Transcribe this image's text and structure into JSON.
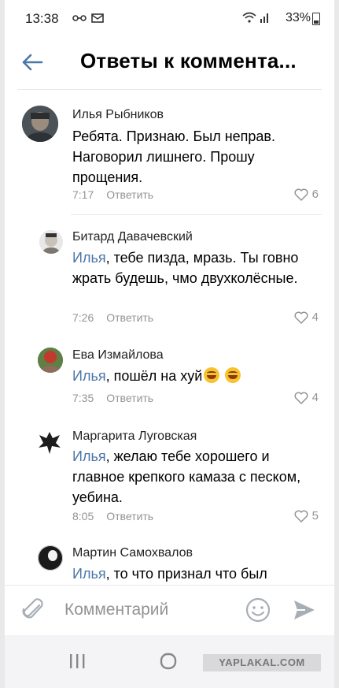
{
  "status_bar": {
    "time": "13:38",
    "battery": "33%"
  },
  "header": {
    "title": "Ответы к коммента..."
  },
  "comments": [
    {
      "author": "Илья Рыбников",
      "mention": "",
      "text": "Ребята. Признаю. Был неправ. Наговорил лишнего. Прошу прощения.",
      "time": "7:17",
      "reply_label": "Ответить",
      "likes": "6"
    },
    {
      "author": "Битард Давачевский",
      "mention": "Илья",
      "text": ", тебе пизда, мразь. Ты говно жрать будешь, чмо двухколёсные.",
      "time": "7:26",
      "reply_label": "Ответить",
      "likes": "4"
    },
    {
      "author": "Ева Измайлова",
      "mention": "Илья",
      "text": ", пошёл на хуй",
      "time": "7:35",
      "reply_label": "Ответить",
      "likes": "4"
    },
    {
      "author": "Маргарита Луговская",
      "mention": "Илья",
      "text": ", желаю тебе хорошего и главное крепкого камаза с песком, уебина.",
      "time": "8:05",
      "reply_label": "Ответить",
      "likes": "5"
    },
    {
      "author": "Мартин Самохвалов",
      "mention": "Илья",
      "text": ", то что признал что был",
      "time": "",
      "reply_label": "",
      "likes": ""
    }
  ],
  "input": {
    "placeholder": "Комментарий"
  },
  "watermark": "YAPLAKAL.COM",
  "colors": {
    "accent": "#4a76a8",
    "muted": "#939393",
    "divider": "#e7e8ec"
  },
  "icons": [
    "back-arrow-icon",
    "heart-icon",
    "paperclip-icon",
    "smile-icon",
    "send-icon",
    "recent-apps-icon",
    "home-icon",
    "nav-back-icon"
  ]
}
